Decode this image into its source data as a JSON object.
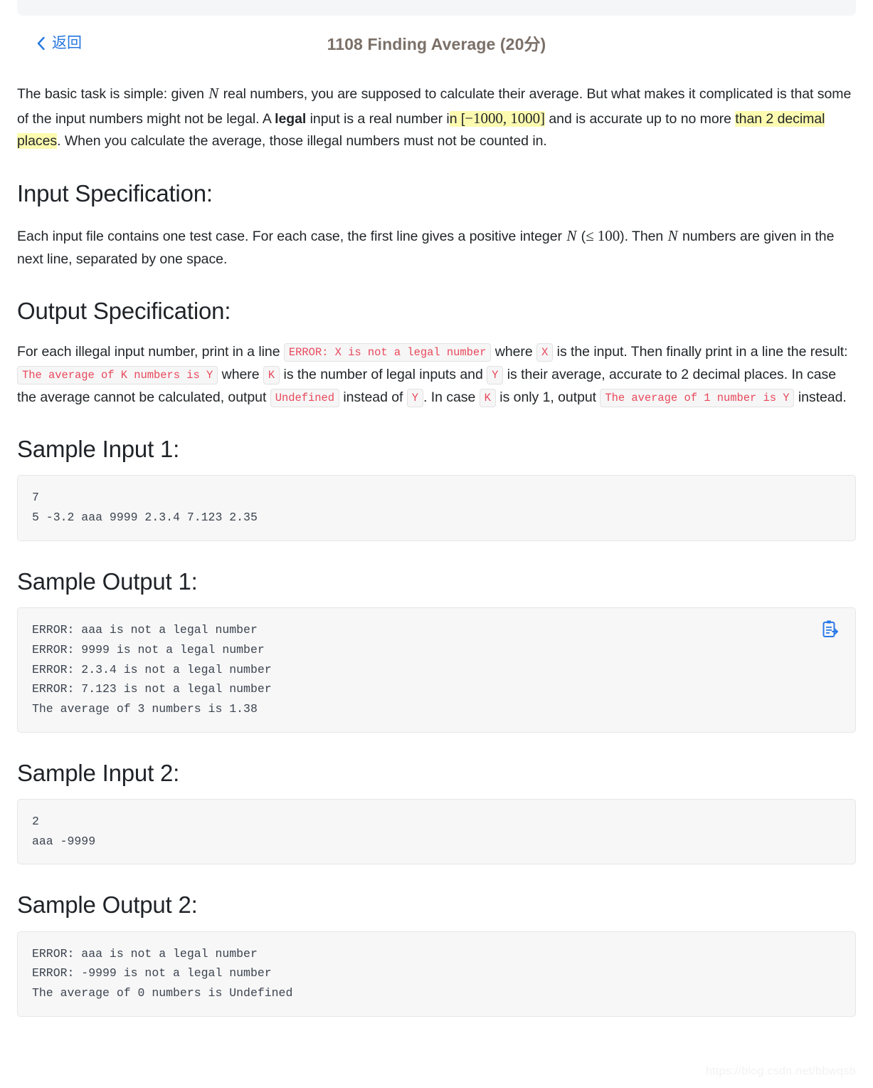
{
  "header": {
    "back_label": "返回",
    "back_icon": "chevron-left-icon",
    "title": "1108 Finding Average (20分)"
  },
  "intro": {
    "t1": "The basic task is simple: given ",
    "m1": "N",
    "t2": " real numbers, you are supposed to calculate their average. But what makes it complicated is that some of the input numbers might not be legal. A ",
    "bold1": "legal",
    "t3": " input is a real number i",
    "hl1": "n [",
    "hl1b": "−1000, ",
    "hl1c": "1000]",
    "t4": " and is accurate up to no more ",
    "hl2": "than 2 decimal places",
    "t5": ". When you calculate the average, those illegal numbers must not be counted in."
  },
  "input_spec": {
    "heading": "Input Specification:",
    "t1": "Each input file contains one test case. For each case, the first line gives a positive integer ",
    "m1": "N",
    "t2": " (",
    "m2": "≤ 100",
    "t3": "). Then ",
    "m3": "N",
    "t4": " numbers are given in the next line, separated by one space."
  },
  "output_spec": {
    "heading": "Output Specification:",
    "t1": "For each illegal input number, print in a line ",
    "c1": "ERROR: X is not a legal number",
    "t2": " where ",
    "c2": "X",
    "t3": " is the input. Then finally print in a line the result: ",
    "c3": "The average of K numbers is Y",
    "t4": " where ",
    "c4": "K",
    "t5": " is the number of legal inputs and ",
    "c5": "Y",
    "t6": " is their average, accurate to 2 decimal places. In case the average cannot be calculated, output ",
    "c6": "Undefined",
    "t7": " instead of ",
    "c7": "Y",
    "t8": ". In case ",
    "c8": "K",
    "t9": " is only 1, output ",
    "c9": "The average of 1 number is Y",
    "t10": " instead."
  },
  "samples": {
    "input1_heading": "Sample Input 1:",
    "input1_code": "7\n5 -3.2 aaa 9999 2.3.4 7.123 2.35",
    "output1_heading": "Sample Output 1:",
    "output1_code": "ERROR: aaa is not a legal number\nERROR: 9999 is not a legal number\nERROR: 2.3.4 is not a legal number\nERROR: 7.123 is not a legal number\nThe average of 3 numbers is 1.38",
    "output1_copy_icon": "copy-to-clipboard-icon",
    "input2_heading": "Sample Input 2:",
    "input2_code": "2\naaa -9999",
    "output2_heading": "Sample Output 2:",
    "output2_code": "ERROR: aaa is not a legal number\nERROR: -9999 is not a legal number\nThe average of 0 numbers is Undefined"
  },
  "watermark": "https://blog.csdn.net/bbwqsb",
  "colors": {
    "link": "#2576e0",
    "title": "#7b7068",
    "inline_code_text": "#e8495c",
    "highlight": "#fdfbb0",
    "code_block_bg": "#f7f7f7",
    "copy_icon": "#2979e8"
  }
}
